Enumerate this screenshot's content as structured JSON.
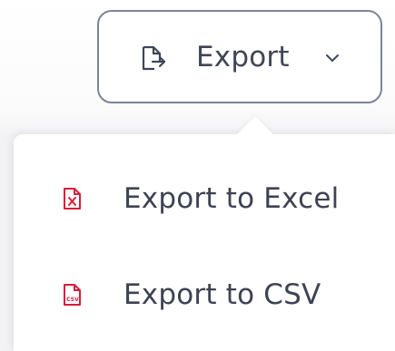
{
  "export_button": {
    "label": "Export",
    "icon": "export-icon",
    "dropdown_icon": "chevron-down-icon"
  },
  "menu": {
    "items": [
      {
        "label": "Export to Excel",
        "icon": "excel-file-icon"
      },
      {
        "label": "Export to CSV",
        "icon": "csv-file-icon",
        "icon_text": "CSV"
      }
    ]
  },
  "colors": {
    "button_border": "#7c8597",
    "text": "#3f4656",
    "menu_icon": "#d61f3a",
    "menu_background": "#ffffff",
    "page_background": "#f2f2f4"
  }
}
